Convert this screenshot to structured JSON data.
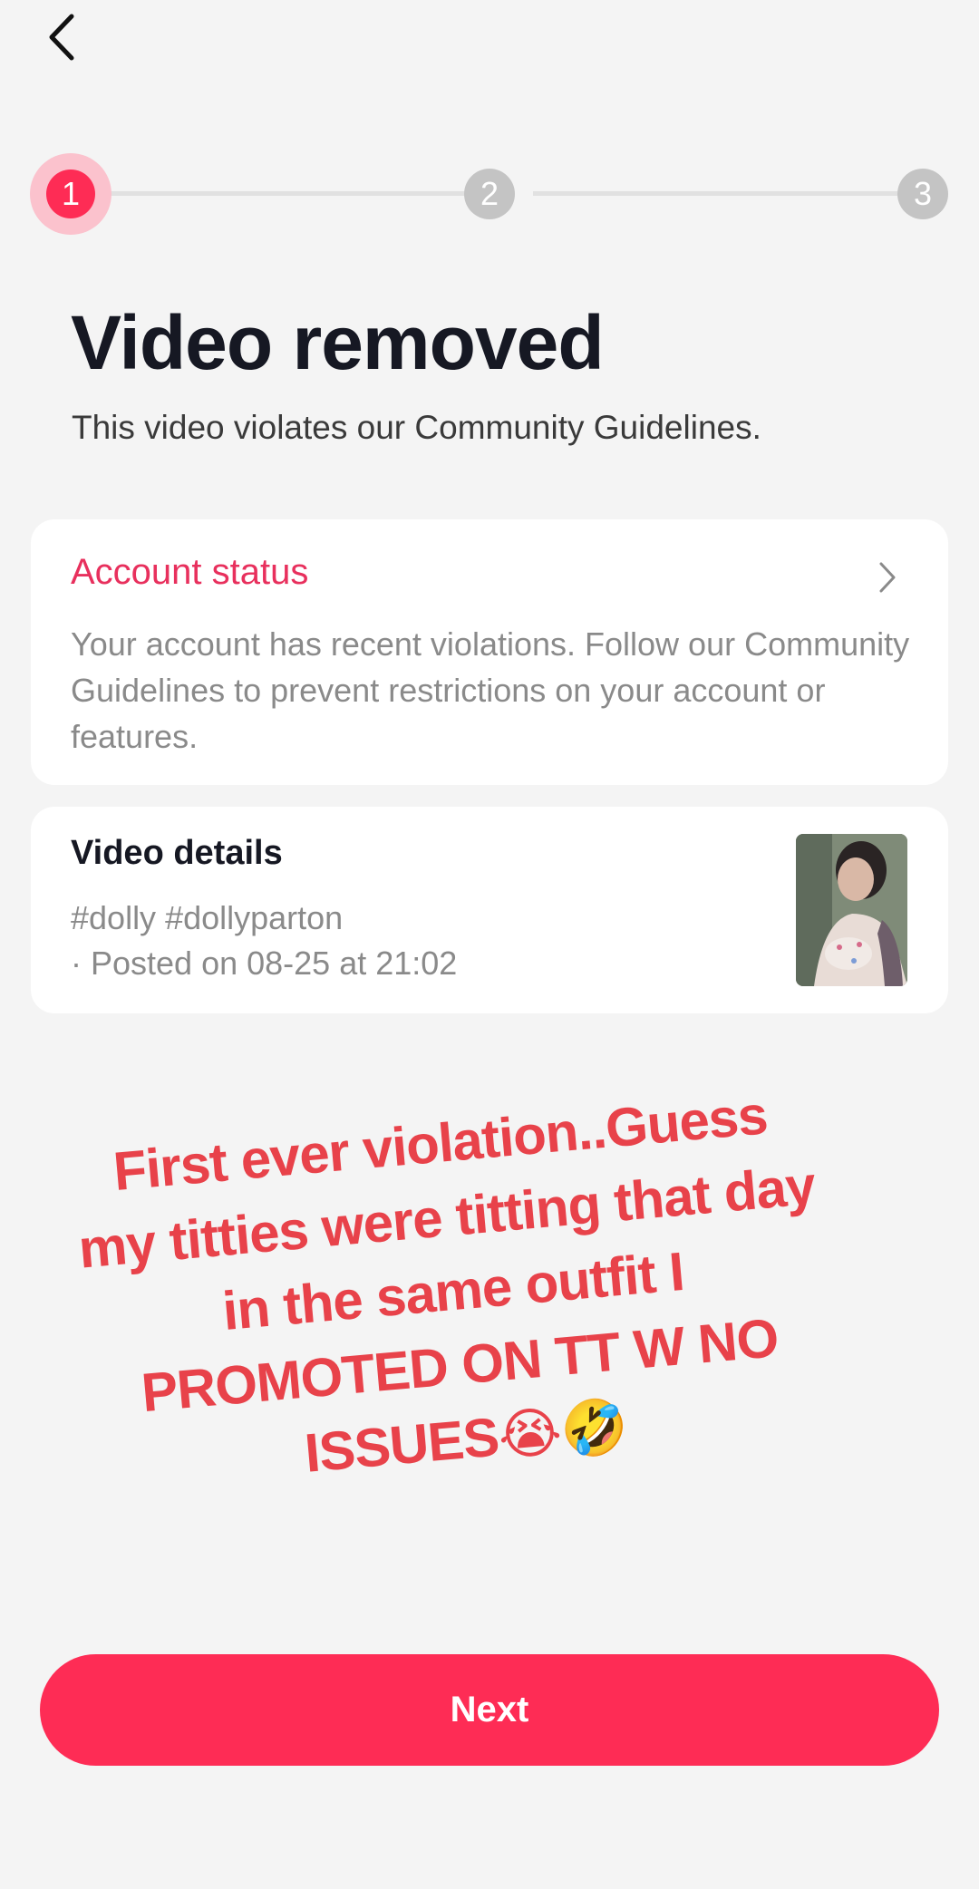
{
  "stepper": {
    "steps": [
      "1",
      "2",
      "3"
    ],
    "current_step": 1
  },
  "header": {
    "title": "Video removed",
    "subtitle": "This video violates our Community Guidelines."
  },
  "account_status": {
    "title": "Account status",
    "body": "Your account has recent violations. Follow our Community Guidelines to prevent restrictions on your account or features."
  },
  "video_details": {
    "title": "Video details",
    "tags": "#dolly #dollyparton",
    "posted": "· Posted on 08-25 at 21:02"
  },
  "overlay": {
    "caption": "First ever violation..Guess my titties were titting that day in the same outfit I PROMOTED ON TT W NO ISSUES😭🤣"
  },
  "footer": {
    "next_label": "Next"
  },
  "colors": {
    "accent": "#fe2c55",
    "accent_light": "#fbc2cd",
    "step_inactive": "#c4c4c4",
    "caption": "#e8424a"
  },
  "icons": {
    "back": "chevron-left-icon",
    "status_chevron": "chevron-right-icon"
  }
}
